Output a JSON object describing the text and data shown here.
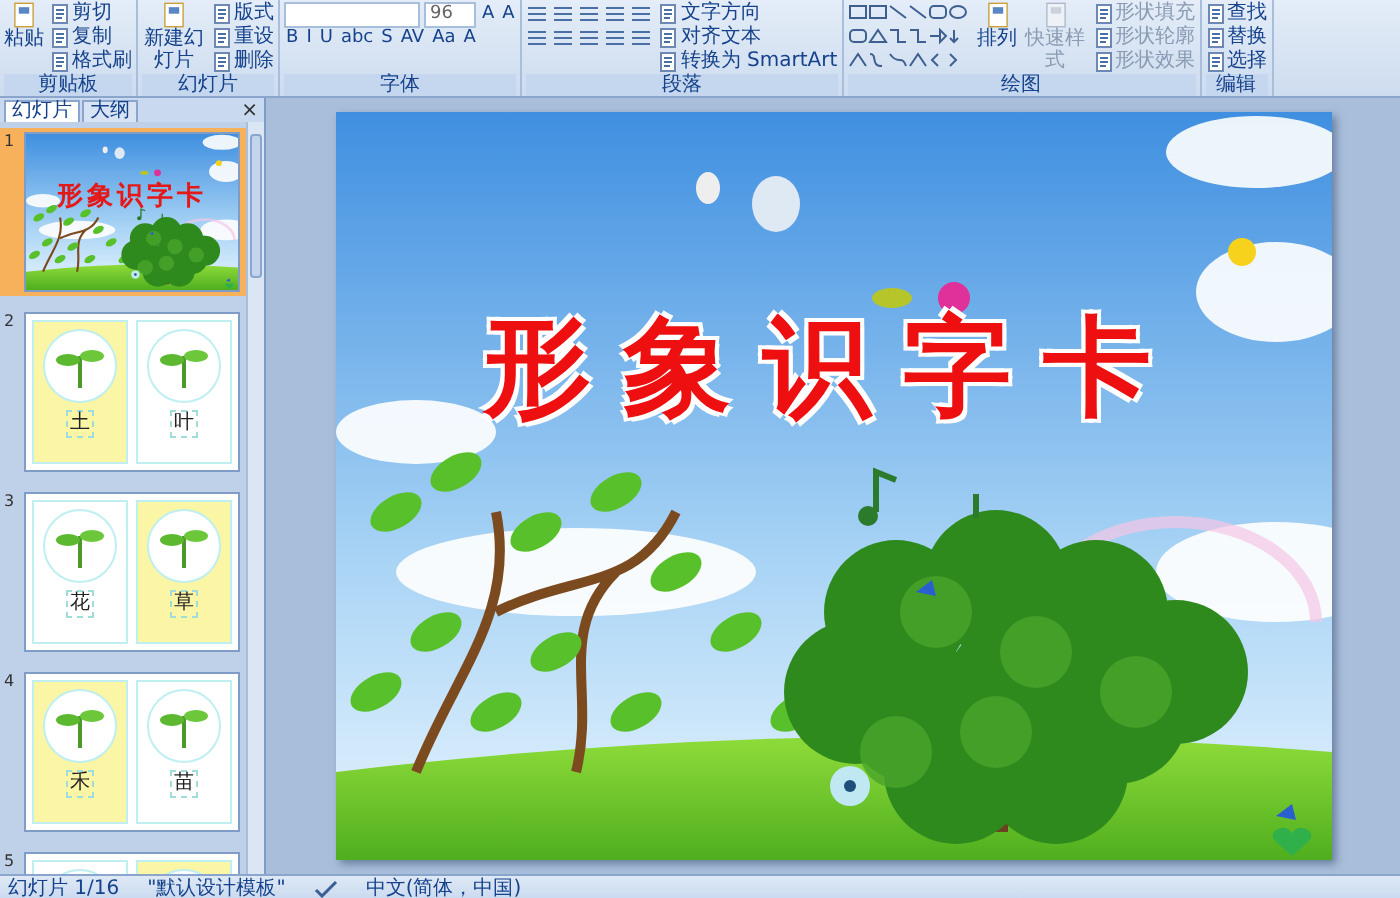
{
  "ribbon": {
    "groups": [
      {
        "label": "剪贴板",
        "columns": [
          {
            "kind": "large",
            "items": [
              "粘贴"
            ]
          },
          {
            "kind": "small",
            "items": [
              "剪切",
              "复制",
              "格式刷"
            ]
          }
        ]
      },
      {
        "label": "幻灯片",
        "columns": [
          {
            "kind": "large",
            "items": [
              "新建幻灯片"
            ]
          },
          {
            "kind": "small",
            "items": [
              "版式",
              "重设",
              "删除"
            ]
          }
        ]
      },
      {
        "label": "字体",
        "columns": [
          {
            "kind": "font",
            "size": "96",
            "grow": [
              "A",
              "A"
            ],
            "glyphs": [
              "B",
              "I",
              "U",
              "abc",
              "S",
              "AV",
              "Aa",
              "A"
            ]
          }
        ]
      },
      {
        "label": "段落",
        "columns": [
          {
            "kind": "paragraph"
          },
          {
            "kind": "small",
            "items": [
              "文字方向",
              "对齐文本",
              "转换为 SmartArt"
            ]
          }
        ]
      },
      {
        "label": "绘图",
        "columns": [
          {
            "kind": "shapes"
          },
          {
            "kind": "large",
            "items": [
              "排列"
            ]
          },
          {
            "kind": "large",
            "items": [
              "快速样式"
            ],
            "disabled": true
          },
          {
            "kind": "small",
            "items": [
              "形状填充",
              "形状轮廓",
              "形状效果"
            ],
            "disabled": true
          }
        ]
      },
      {
        "label": "编辑",
        "columns": [
          {
            "kind": "small",
            "items": [
              "查找",
              "替换",
              "选择"
            ]
          }
        ]
      }
    ]
  },
  "panel": {
    "tabs": [
      {
        "label": "幻灯片",
        "selected": true
      },
      {
        "label": "大纲",
        "selected": false
      }
    ],
    "close": "×",
    "slides": [
      {
        "number": "1",
        "selected": true,
        "kind": "title",
        "title": "形象识字卡"
      },
      {
        "number": "2",
        "selected": false,
        "kind": "cards",
        "cards": [
          {
            "char": "土",
            "color": "#fbf5a6"
          },
          {
            "char": "叶",
            "color": "#ffffff"
          }
        ]
      },
      {
        "number": "3",
        "selected": false,
        "kind": "cards",
        "cards": [
          {
            "char": "花",
            "color": "#ffffff"
          },
          {
            "char": "草",
            "color": "#fbf5a6"
          }
        ]
      },
      {
        "number": "4",
        "selected": false,
        "kind": "cards",
        "cards": [
          {
            "char": "禾",
            "color": "#fbf5a6"
          },
          {
            "char": "苗",
            "color": "#ffffff"
          }
        ]
      },
      {
        "number": "5",
        "selected": false,
        "kind": "cards",
        "cards": [
          {
            "color": "#ffffff"
          },
          {
            "color": "#fbf5a6"
          }
        ]
      }
    ]
  },
  "slide": {
    "title": "形象识字卡"
  },
  "status_bar": {
    "slide_info": "幻灯片 1/16",
    "theme": "\"默认设计模板\"",
    "language": "中文(简体，中国)"
  }
}
